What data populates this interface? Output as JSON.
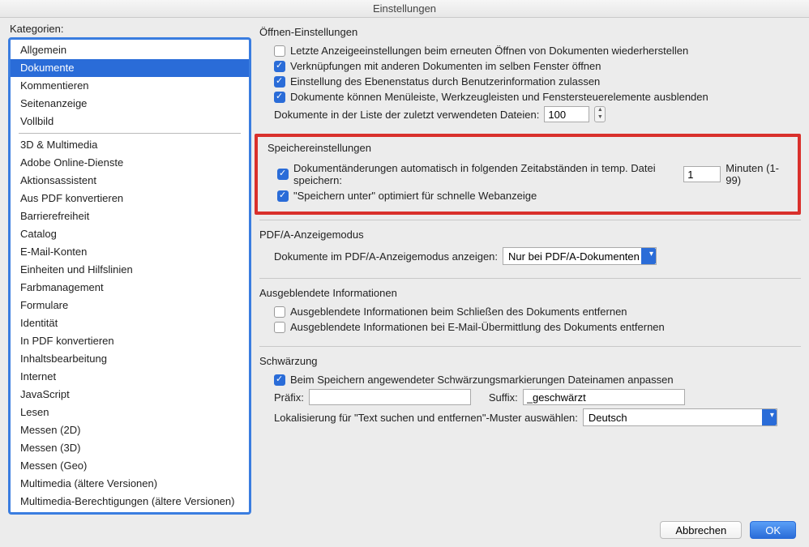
{
  "window": {
    "title": "Einstellungen"
  },
  "categories_label": "Kategorien:",
  "categories_top": [
    "Allgemein",
    "Dokumente",
    "Kommentieren",
    "Seitenanzeige",
    "Vollbild"
  ],
  "categories_rest": [
    "3D & Multimedia",
    "Adobe Online-Dienste",
    "Aktionsassistent",
    "Aus PDF konvertieren",
    "Barrierefreiheit",
    "Catalog",
    "E-Mail-Konten",
    "Einheiten und Hilfslinien",
    "Farbmanagement",
    "Formulare",
    "Identität",
    "In PDF konvertieren",
    "Inhaltsbearbeitung",
    "Internet",
    "JavaScript",
    "Lesen",
    "Messen (2D)",
    "Messen (3D)",
    "Messen (Geo)",
    "Multimedia (ältere Versionen)",
    "Multimedia-Berechtigungen (ältere Versionen)"
  ],
  "selected_category": "Dokumente",
  "open": {
    "title": "Öffnen-Einstellungen",
    "cb1": "Letzte Anzeigeeinstellungen beim erneuten Öffnen von Dokumenten wiederherstellen",
    "cb2": "Verknüpfungen mit anderen Dokumenten im selben Fenster öffnen",
    "cb3": "Einstellung des Ebenenstatus durch Benutzerinformation zulassen",
    "cb4": "Dokumente können Menüleiste, Werkzeugleisten und Fenstersteuerelemente ausblenden",
    "recent_label": "Dokumente in der Liste der zuletzt verwendeten Dateien:",
    "recent_value": "100"
  },
  "save": {
    "title": "Speichereinstellungen",
    "cb1": "Dokumentänderungen automatisch in folgenden Zeitabständen in temp. Datei speichern:",
    "interval_value": "1",
    "interval_suffix": "Minuten (1-99)",
    "cb2": "\"Speichern unter\" optimiert für schnelle Webanzeige"
  },
  "pdfa": {
    "title": "PDF/A-Anzeigemodus",
    "label": "Dokumente im PDF/A-Anzeigemodus anzeigen:",
    "value": "Nur bei PDF/A-Dokumenten"
  },
  "hidden": {
    "title": "Ausgeblendete Informationen",
    "cb1": "Ausgeblendete Informationen beim Schließen des Dokuments entfernen",
    "cb2": "Ausgeblendete Informationen bei E-Mail-Übermittlung des Dokuments entfernen"
  },
  "redact": {
    "title": "Schwärzung",
    "cb1": "Beim Speichern angewendeter Schwärzungsmarkierungen Dateinamen anpassen",
    "prefix_label": "Präfix:",
    "prefix_value": "",
    "suffix_label": "Suffix:",
    "suffix_value": "_geschwärzt",
    "locale_label": "Lokalisierung für \"Text suchen und entfernen\"-Muster auswählen:",
    "locale_value": "Deutsch"
  },
  "buttons": {
    "cancel": "Abbrechen",
    "ok": "OK"
  }
}
